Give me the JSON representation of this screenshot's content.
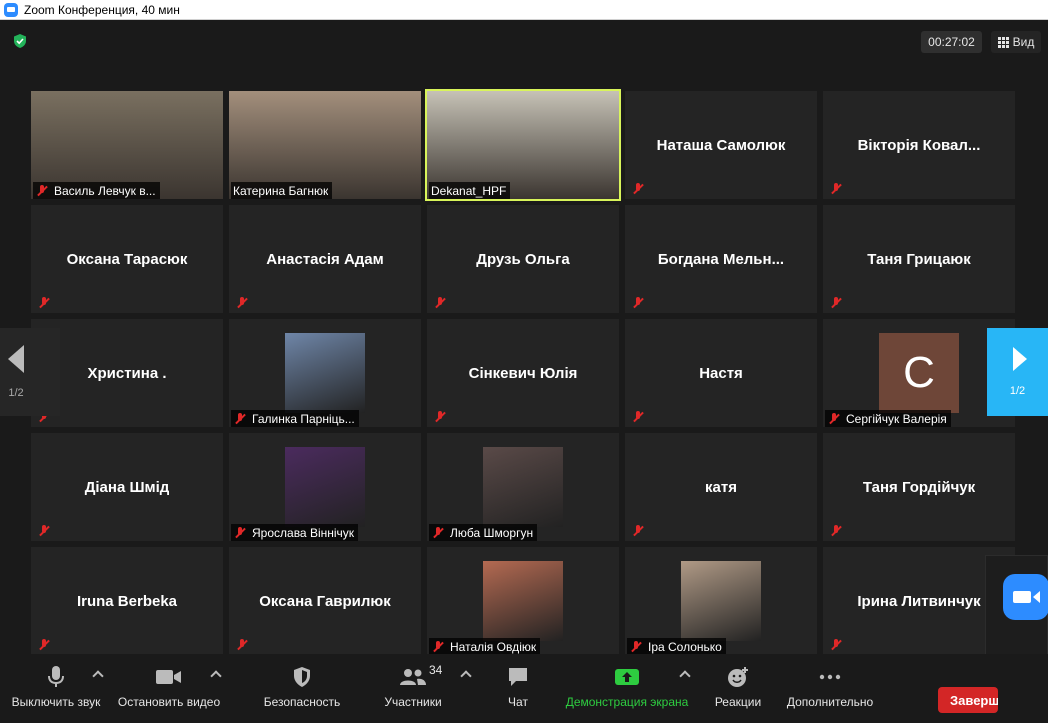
{
  "window": {
    "title": "Zoom Конференция, 40 мин"
  },
  "header": {
    "timer": "00:27:02",
    "view_label": "Вид"
  },
  "pagination": {
    "left": "1/2",
    "right": "1/2"
  },
  "tiles": [
    {
      "name": "Василь Левчук в...",
      "kind": "video",
      "bg": "#7a7060"
    },
    {
      "name": "Катерина Багнюк",
      "kind": "video",
      "bg": "#a38f7c"
    },
    {
      "name": "Dekanat_HPF",
      "kind": "video",
      "bg": "#c6c2b6",
      "active": true
    },
    {
      "name": "Наташа Самолюк",
      "kind": "text"
    },
    {
      "name": "Вікторія Ковал...",
      "kind": "text"
    },
    {
      "name": "Оксана Тарасюк",
      "kind": "text"
    },
    {
      "name": "Анастасія Адам",
      "kind": "text"
    },
    {
      "name": "Друзь Ольга",
      "kind": "text"
    },
    {
      "name": "Богдана  Мельн...",
      "kind": "text"
    },
    {
      "name": "Таня Грицаюк",
      "kind": "text"
    },
    {
      "name": "Христина .",
      "kind": "text"
    },
    {
      "name": "Галинка Парніць...",
      "kind": "avatar",
      "avatar_color": "#6f86a8"
    },
    {
      "name": "Сінкевич Юлія",
      "kind": "text"
    },
    {
      "name": "Настя",
      "kind": "text"
    },
    {
      "name": "Сергійчук Валерія",
      "kind": "letter",
      "letter": "C"
    },
    {
      "name": "Діана Шмід",
      "kind": "text"
    },
    {
      "name": "Ярослава Віннічук",
      "kind": "avatar",
      "avatar_color": "#4b2b5e"
    },
    {
      "name": "Люба Шморгун",
      "kind": "avatar",
      "avatar_color": "#5a4a48"
    },
    {
      "name": "катя",
      "kind": "text"
    },
    {
      "name": "Таня Гордійчук",
      "kind": "text"
    },
    {
      "name": "Iruna Berbeka",
      "kind": "text"
    },
    {
      "name": "Оксана Гаврилюк",
      "kind": "text"
    },
    {
      "name": "Наталія Овдіюк",
      "kind": "avatar",
      "avatar_color": "#b46a52"
    },
    {
      "name": "Іра Солонько",
      "kind": "avatar",
      "avatar_color": "#b09a86"
    },
    {
      "name": "Ірина Литвинчук",
      "kind": "text"
    }
  ],
  "toolbar": {
    "mute": "Выключить звук",
    "stop_video": "Остановить видео",
    "security": "Безопасность",
    "participants": "Участники",
    "participants_count": "34",
    "chat": "Чат",
    "share": "Демонстрация экрана",
    "reactions": "Реакции",
    "more": "Дополнительно",
    "end": "Завершить"
  },
  "colors": {
    "accent": "#2d8cff",
    "share_green": "#2ecc40",
    "end_red": "#d32626",
    "active_border": "#d8f45a",
    "nav_blue": "#28b6f6"
  }
}
